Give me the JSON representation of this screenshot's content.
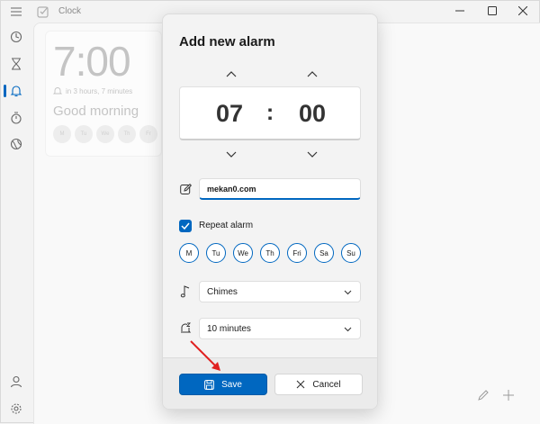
{
  "window": {
    "title": "Clock"
  },
  "background_alarm": {
    "time": "7:00",
    "subtitle": "in 3 hours, 7 minutes",
    "name": "Good morning",
    "days": [
      "M",
      "Tu",
      "We",
      "Th",
      "Fr"
    ]
  },
  "dialog": {
    "title": "Add new alarm",
    "hour": "07",
    "separator": ":",
    "minute": "00",
    "alarm_name_value": "mekan0.com",
    "repeat_label": "Repeat alarm",
    "repeat_checked": true,
    "days": [
      "M",
      "Tu",
      "We",
      "Th",
      "Fri",
      "Sa",
      "Su"
    ],
    "sound_value": "Chimes",
    "snooze_value": "10 minutes",
    "save_label": "Save",
    "cancel_label": "Cancel"
  },
  "colors": {
    "accent": "#0067c0",
    "arrow": "#e02020"
  },
  "icons": {
    "sidebar": [
      "menu-icon",
      "focus-icon",
      "timer-icon",
      "alarm-icon",
      "stopwatch-icon",
      "world-clock-icon",
      "account-icon",
      "settings-icon"
    ],
    "window_controls": [
      "minimize-icon",
      "maximize-icon",
      "close-icon"
    ]
  }
}
